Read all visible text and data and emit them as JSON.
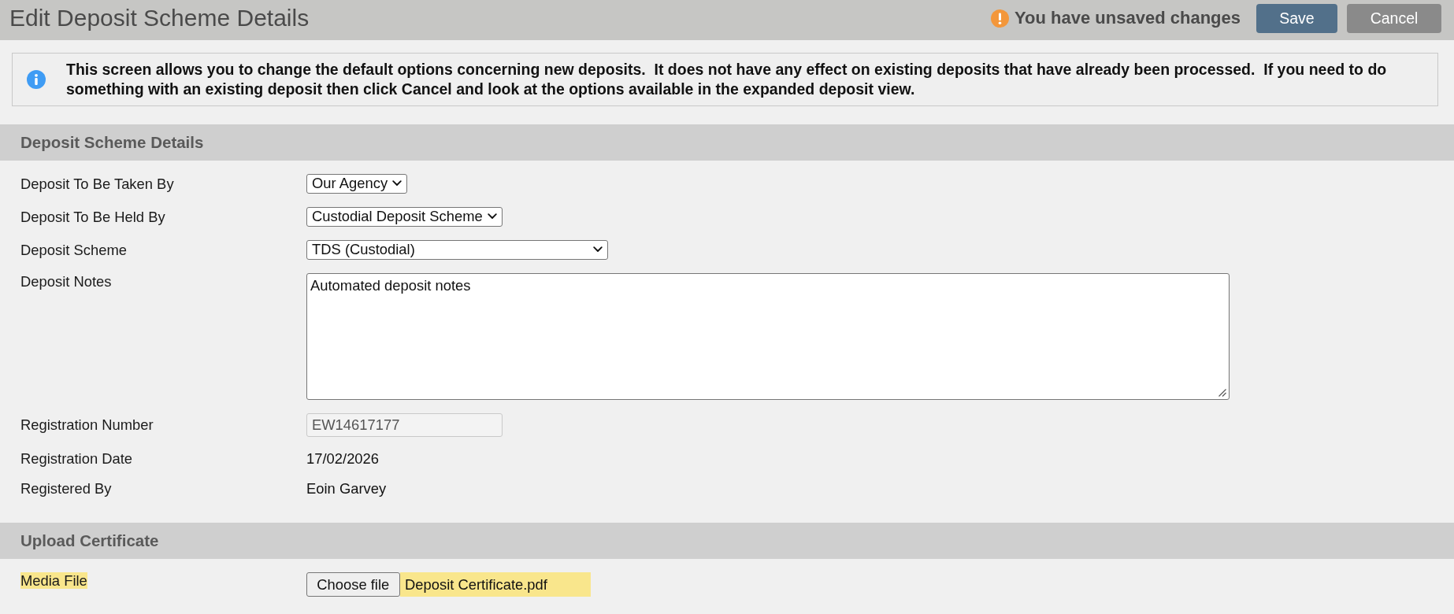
{
  "header": {
    "title": "Edit Deposit Scheme Details",
    "notice": "You have unsaved changes",
    "buttons": [
      {
        "label": "Save",
        "kind": "primary"
      },
      {
        "label": "Cancel",
        "kind": "secondary"
      }
    ]
  },
  "info_message": "This screen allows you to change the default options concerning new deposits.  It does not have any effect on existing deposits that have already been processed.  If you need to do something with an existing deposit then click Cancel and look at the options available in the expanded deposit view.",
  "sections": [
    {
      "title": "Deposit Scheme Details",
      "fields": [
        {
          "kind": "select",
          "label": "Deposit To Be Taken By",
          "value": "Our Agency",
          "changed": false
        },
        {
          "kind": "select",
          "label": "Deposit To Be Held By",
          "value": "Custodial Deposit Scheme",
          "changed": false
        },
        {
          "kind": "select",
          "label": "Deposit Scheme",
          "value": "TDS (Custodial)",
          "changed": false
        },
        {
          "kind": "textarea",
          "label": "Deposit Notes",
          "value": "Automated deposit notes",
          "changed": false
        },
        {
          "kind": "text",
          "label": "Registration Number",
          "value": "EW14617177",
          "disabled": true,
          "changed": false
        },
        {
          "kind": "static",
          "label": "Registration Date",
          "value": "17/02/2026",
          "changed": false
        },
        {
          "kind": "static",
          "label": "Registered By",
          "value": "Eoin Garvey",
          "changed": false
        }
      ]
    },
    {
      "title": "Upload Certificate",
      "fields": [
        {
          "kind": "file",
          "label": "Media File",
          "button": "Choose file",
          "value": "Deposit Certificate.pdf",
          "changed": true
        }
      ]
    }
  ]
}
